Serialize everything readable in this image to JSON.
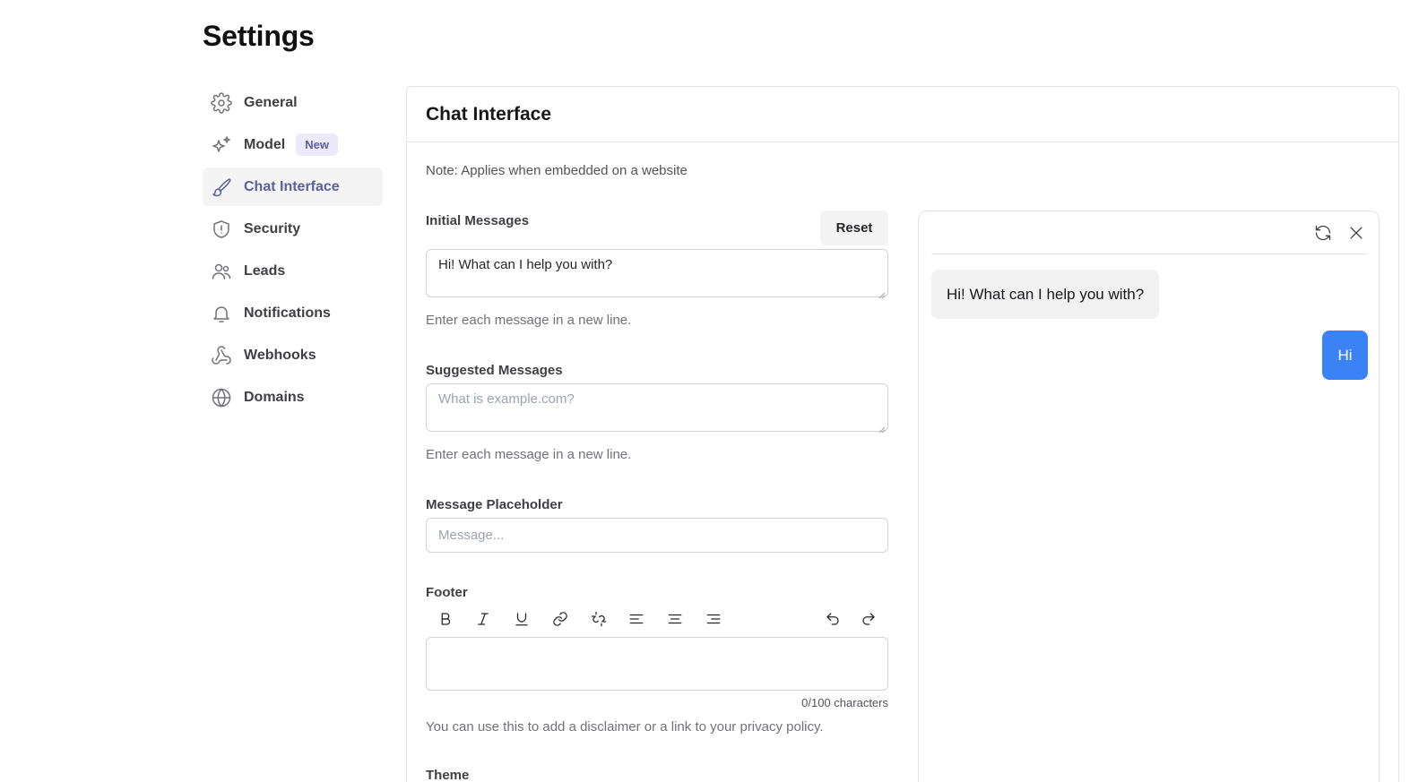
{
  "page": {
    "title": "Settings"
  },
  "sidebar": {
    "items": [
      {
        "label": "General",
        "icon": "gear-icon"
      },
      {
        "label": "Model",
        "icon": "sparkles-icon",
        "badge": "New"
      },
      {
        "label": "Chat Interface",
        "icon": "brush-icon",
        "active": true
      },
      {
        "label": "Security",
        "icon": "shield-icon"
      },
      {
        "label": "Leads",
        "icon": "users-icon"
      },
      {
        "label": "Notifications",
        "icon": "bell-icon"
      },
      {
        "label": "Webhooks",
        "icon": "webhook-icon"
      },
      {
        "label": "Domains",
        "icon": "globe-icon"
      }
    ]
  },
  "main": {
    "title": "Chat Interface",
    "note": "Note: Applies when embedded on a website",
    "initial_messages": {
      "label": "Initial Messages",
      "reset_label": "Reset",
      "value": "Hi! What can I help you with?",
      "help": "Enter each message in a new line."
    },
    "suggested_messages": {
      "label": "Suggested Messages",
      "placeholder": "What is example.com?",
      "help": "Enter each message in a new line."
    },
    "message_placeholder": {
      "label": "Message Placeholder",
      "placeholder": "Message..."
    },
    "footer": {
      "label": "Footer",
      "toolbar": [
        "bold-icon",
        "italic-icon",
        "underline-icon",
        "link-icon",
        "unlink-icon",
        "align-left-icon",
        "align-center-icon",
        "align-right-icon",
        "undo-icon",
        "redo-icon"
      ],
      "char_count": "0/100 characters",
      "help": "You can use this to add a disclaimer or a link to your privacy policy."
    },
    "theme": {
      "label": "Theme"
    }
  },
  "preview": {
    "bot_message": "Hi! What can I help you with?",
    "user_message": "Hi",
    "user_bubble_color": "#3b82f6",
    "icons": [
      "refresh-icon",
      "close-icon"
    ]
  },
  "colors": {
    "accent": "#5b5f9a",
    "badge_bg": "#ece9fb",
    "user_bubble": "#3b82f6"
  }
}
